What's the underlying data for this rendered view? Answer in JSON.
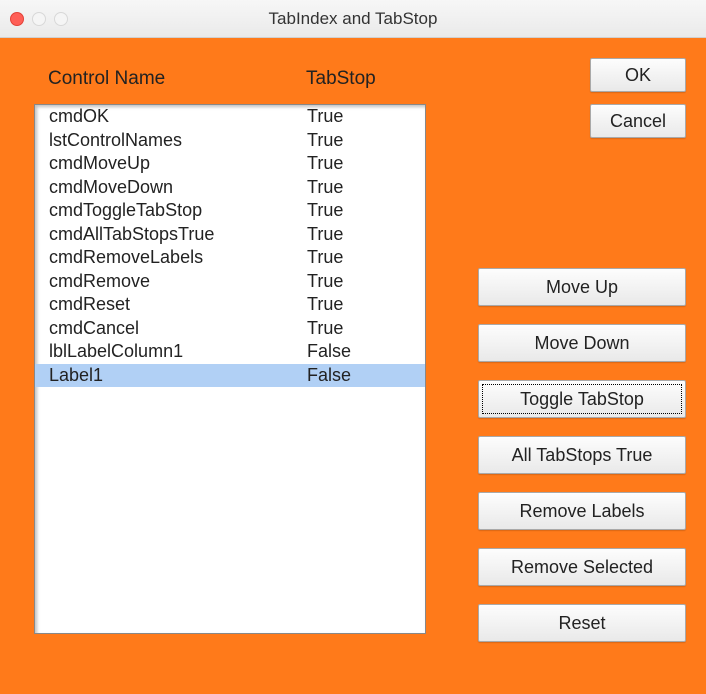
{
  "window": {
    "title": "TabIndex and TabStop"
  },
  "headers": {
    "control_name": "Control Name",
    "tabstop": "TabStop"
  },
  "list": {
    "selected_index": 11,
    "rows": [
      {
        "name": "cmdOK",
        "tabstop": "True"
      },
      {
        "name": "lstControlNames",
        "tabstop": "True"
      },
      {
        "name": "cmdMoveUp",
        "tabstop": "True"
      },
      {
        "name": "cmdMoveDown",
        "tabstop": "True"
      },
      {
        "name": "cmdToggleTabStop",
        "tabstop": "True"
      },
      {
        "name": "cmdAllTabStopsTrue",
        "tabstop": "True"
      },
      {
        "name": "cmdRemoveLabels",
        "tabstop": "True"
      },
      {
        "name": "cmdRemove",
        "tabstop": "True"
      },
      {
        "name": "cmdReset",
        "tabstop": "True"
      },
      {
        "name": "cmdCancel",
        "tabstop": "True"
      },
      {
        "name": "lblLabelColumn1",
        "tabstop": "False"
      },
      {
        "name": "Label1",
        "tabstop": "False"
      }
    ]
  },
  "buttons": {
    "ok": "OK",
    "cancel": "Cancel",
    "move_up": "Move Up",
    "move_down": "Move Down",
    "toggle_tabstop": "Toggle TabStop",
    "all_tabstops_true": "All TabStops True",
    "remove_labels": "Remove Labels",
    "remove_selected": "Remove Selected",
    "reset": "Reset"
  }
}
